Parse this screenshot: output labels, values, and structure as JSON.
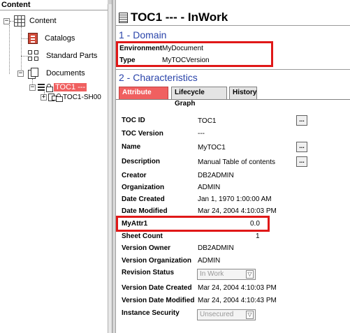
{
  "tree": {
    "header": "Content",
    "root": "Content",
    "items": [
      {
        "label": "Catalogs",
        "icon": "book-icon"
      },
      {
        "label": "Standard Parts",
        "icon": "parts-icon"
      },
      {
        "label": "Documents",
        "icon": "documents-icon"
      }
    ],
    "selected": "TOC1 ---",
    "child": "TOC1-SH00"
  },
  "header": {
    "title": "TOC1 --- - InWork",
    "icon": "document-list-icon"
  },
  "domain": {
    "heading": "1 - Domain",
    "environment_label": "Environment",
    "environment_value": "MyDocument",
    "type_label": "Type",
    "type_value": "MyTOCVersion"
  },
  "characteristics": {
    "heading": "2 - Characteristics",
    "tabs": [
      "Attribute View",
      "Lifecycle Graph",
      "History"
    ],
    "active_tab": "Attribute View"
  },
  "attributes": [
    {
      "label": "TOC ID",
      "value": "TOC1"
    },
    {
      "label": "TOC Version",
      "value": "---"
    },
    {
      "label": "Name",
      "value": "MyTOC1"
    },
    {
      "label": "Description",
      "value": "Manual Table of contents"
    },
    {
      "label": "Creator",
      "value": "DB2ADMIN"
    },
    {
      "label": "Organization",
      "value": "ADMIN"
    },
    {
      "label": "Date Created",
      "value": "Jan 1, 1970 1:00:00 AM"
    },
    {
      "label": "Date Modified",
      "value": "Mar 24, 2004 4:10:03 PM"
    },
    {
      "label": "MyAttr1",
      "value": "0.0"
    },
    {
      "label": "Sheet Count",
      "value": "1"
    },
    {
      "label": "Version Owner",
      "value": "DB2ADMIN"
    },
    {
      "label": "Version Organization",
      "value": "ADMIN"
    },
    {
      "label": "Revision Status",
      "value": "In Work"
    },
    {
      "label": "Version Date Created",
      "value": "Mar 24, 2004 4:10:03 PM"
    },
    {
      "label": "Version Date Modified",
      "value": "Mar 24, 2004 4:10:43 PM"
    },
    {
      "label": "Instance Security",
      "value": "Unsecured"
    }
  ],
  "button_label": "...",
  "dropdown_arrow": "▽",
  "colors": {
    "accent_blue": "#2a44aa",
    "selection_red": "#f06060",
    "highlight_red": "#e01818"
  }
}
